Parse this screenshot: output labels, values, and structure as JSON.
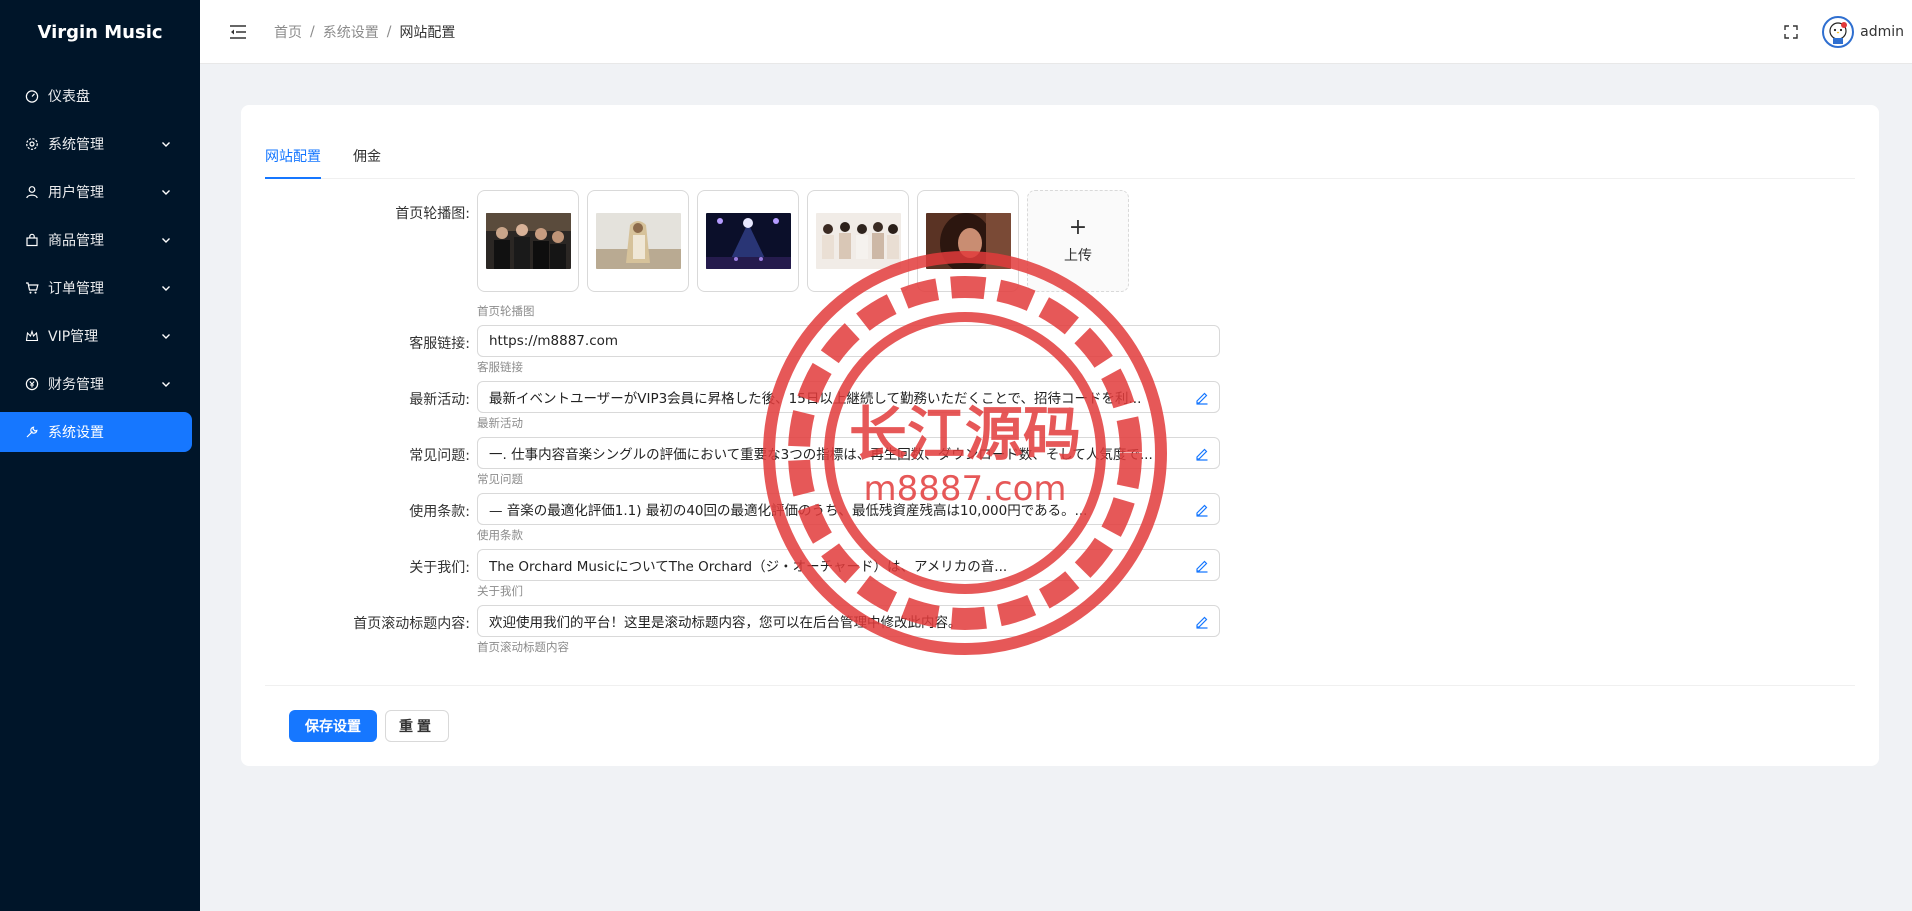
{
  "app": {
    "brand": "Virgin Music"
  },
  "sidebar": {
    "items": [
      {
        "label": "仪表盘",
        "icon": "dashboard-icon",
        "expandable": false,
        "active": false
      },
      {
        "label": "系统管理",
        "icon": "gear-icon",
        "expandable": true,
        "active": false
      },
      {
        "label": "用户管理",
        "icon": "user-icon",
        "expandable": true,
        "active": false
      },
      {
        "label": "商品管理",
        "icon": "shopping-bag-icon",
        "expandable": true,
        "active": false
      },
      {
        "label": "订单管理",
        "icon": "cart-icon",
        "expandable": true,
        "active": false
      },
      {
        "label": "VIP管理",
        "icon": "crown-icon",
        "expandable": true,
        "active": false
      },
      {
        "label": "财务管理",
        "icon": "money-icon",
        "expandable": true,
        "active": false
      },
      {
        "label": "系统设置",
        "icon": "tool-icon",
        "expandable": false,
        "active": true
      }
    ]
  },
  "header": {
    "breadcrumb": [
      "首页",
      "系统设置",
      "网站配置"
    ],
    "user": "admin"
  },
  "tabs": [
    {
      "label": "网站配置",
      "active": true
    },
    {
      "label": "佣金",
      "active": false
    }
  ],
  "form": {
    "carousel": {
      "label": "首页轮播图:",
      "help": "首页轮播图",
      "upload_label": "上传",
      "images": [
        {
          "name": "band-photo-1"
        },
        {
          "name": "artist-photo-2"
        },
        {
          "name": "concert-photo-3"
        },
        {
          "name": "group-photo-4"
        },
        {
          "name": "portrait-photo-5"
        }
      ]
    },
    "support_link": {
      "label": "客服链接:",
      "value": "https://m8887.com",
      "help": "客服链接"
    },
    "latest_events": {
      "label": "最新活动:",
      "value": "最新イベントユーザーがVIP3会員に昇格した後、15日以上継続して勤務いただくことで、招待コードを利...",
      "help": "最新活动"
    },
    "faq": {
      "label": "常见问题:",
      "value": "一. 仕事内容音楽シングルの評価において重要な3つの指標は、再生回数、ダウンロード数、そして人気度で...",
      "help": "常见问题"
    },
    "terms": {
      "label": "使用条款:",
      "value": "— 音楽の最適化評価1.1) 最初の40回の最適化評価のうち、最低残資産残高は10,000円である。...",
      "help": "使用条款"
    },
    "about": {
      "label": "关于我们:",
      "value": "The Orchard MusicについてThe Orchard（ジ・オーチャード）は、アメリカの音...",
      "help": "关于我们"
    },
    "marquee": {
      "label": "首页滚动标题内容:",
      "value": "欢迎使用我们的平台！这里是滚动标题内容，您可以在后台管理中修改此内容。",
      "help": "首页滚动标题内容"
    }
  },
  "actions": {
    "save": "保存设置",
    "reset": "重置"
  },
  "watermark": {
    "text": "长江源码",
    "url": "m8887.com",
    "color": "#e23b3b"
  },
  "colors": {
    "primary": "#1677ff",
    "sidebar_bg": "#001529"
  }
}
